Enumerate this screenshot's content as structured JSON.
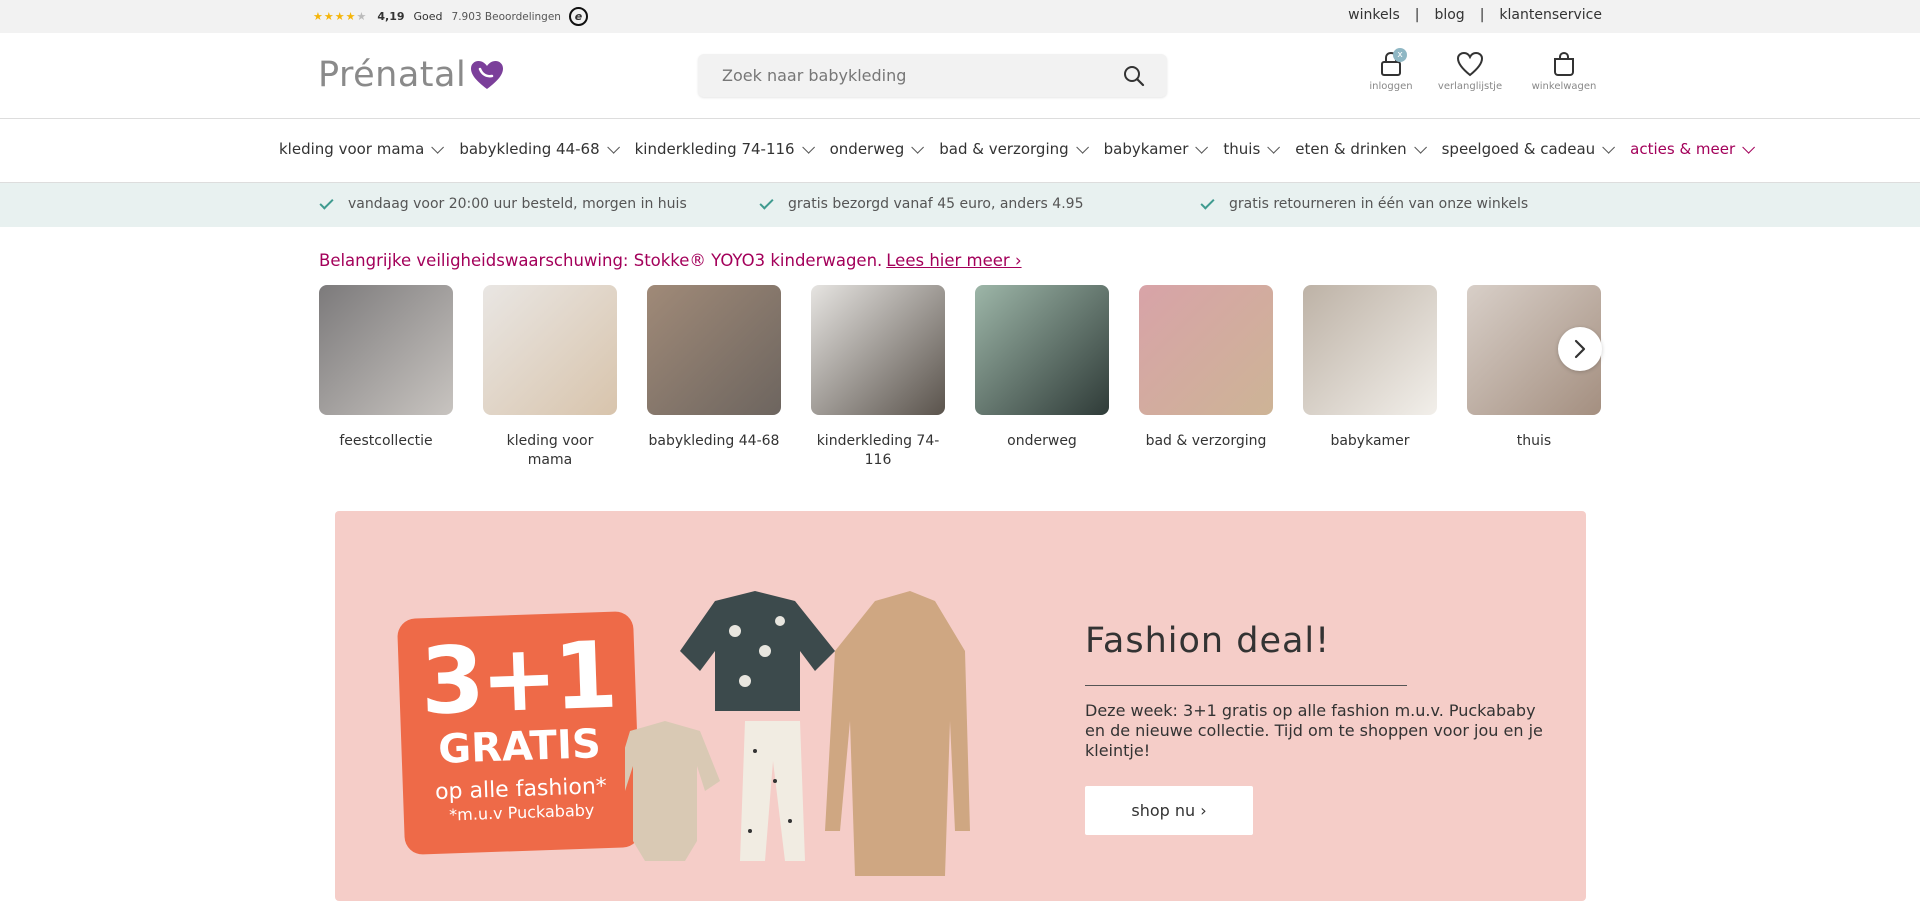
{
  "topbar": {
    "rating_score": "4,19",
    "rating_label": "Goed",
    "rating_count": "7.903 Beoordelingen",
    "trust_mark": "e",
    "links": [
      "winkels",
      "blog",
      "klantenservice"
    ],
    "separator": "|"
  },
  "header": {
    "logo_text": "Prénatal",
    "search_placeholder": "Zoek naar babykleding",
    "icons": [
      {
        "label": "inloggen",
        "icon": "lock-icon",
        "badge": "x"
      },
      {
        "label": "verlanglijstje",
        "icon": "heart-icon"
      },
      {
        "label": "winkelwagen",
        "icon": "bag-icon"
      }
    ]
  },
  "nav": {
    "items": [
      "kleding voor mama",
      "babykleding 44-68",
      "kinderkleding 74-116",
      "onderweg",
      "bad & verzorging",
      "babykamer",
      "thuis",
      "eten & drinken",
      "speelgoed & cadeau",
      "acties & meer"
    ]
  },
  "usp": [
    "vandaag voor 20:00 uur besteld, morgen in huis",
    "gratis bezorgd vanaf 45 euro, anders 4.95",
    "gratis retourneren in één van onze winkels"
  ],
  "warning": {
    "text": "Belangrijke veiligheidswaarschuwing: Stokke® YOYO3 kinderwagen.",
    "link": "Lees hier meer ›"
  },
  "categories": [
    {
      "name": "feestcollectie",
      "colors": [
        "#7c7a7b",
        "#c8c4c0"
      ]
    },
    {
      "name": "kleding voor mama",
      "colors": [
        "#e9e6e3",
        "#d8c4ac"
      ]
    },
    {
      "name": "babykleding 44-68",
      "colors": [
        "#a08a78",
        "#6d655f"
      ]
    },
    {
      "name": "kinderkleding 74-116",
      "colors": [
        "#e6e4e1",
        "#5a534c"
      ]
    },
    {
      "name": "onderweg",
      "colors": [
        "#9db6a8",
        "#2f3b38"
      ]
    },
    {
      "name": "bad & verzorging",
      "colors": [
        "#d8a3a8",
        "#cdb496"
      ]
    },
    {
      "name": "babykamer",
      "colors": [
        "#bdb2a6",
        "#f2efea"
      ]
    },
    {
      "name": "thuis",
      "colors": [
        "#d8cfc8",
        "#a48f80"
      ]
    }
  ],
  "promo": {
    "badge_big": "3+1",
    "badge_gratis": "GRATIS",
    "badge_fashion": "op alle fashion*",
    "badge_muv": "*m.u.v Puckababy",
    "title": "Fashion deal!",
    "body": "Deze week: 3+1 gratis op alle fashion m.u.v. Puckababy en de nieuwe collectie. Tijd om te shoppen voor jou en je kleintje!",
    "button": "shop nu ›"
  },
  "colors": {
    "brand": "#a3005a",
    "usp_bg": "#e8f1f0",
    "promo_bg": "#f5cdc8",
    "badge_orange": "#ee6a48"
  }
}
